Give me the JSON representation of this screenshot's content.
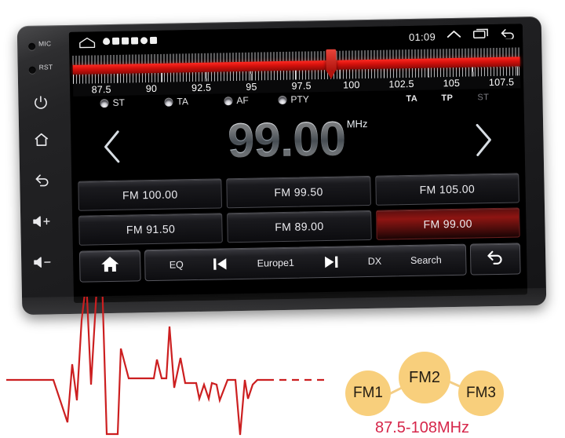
{
  "device": {
    "left_buttons": [
      {
        "name": "mic-hole",
        "label": "MIC",
        "icon": "hole"
      },
      {
        "name": "reset-hole",
        "label": "RST",
        "icon": "hole"
      },
      {
        "name": "power-button",
        "label": "",
        "icon": "power-icon"
      },
      {
        "name": "home-button",
        "label": "",
        "icon": "home-icon"
      },
      {
        "name": "back-button",
        "label": "",
        "icon": "back-arrow-icon"
      },
      {
        "name": "volume-up-button",
        "label": "",
        "icon": "volume-up-icon"
      },
      {
        "name": "volume-down-button",
        "label": "",
        "icon": "volume-down-icon"
      }
    ]
  },
  "statusbar": {
    "home_icon": "home-icon",
    "tray_icons": [
      "location-pin-icon",
      "image-icon",
      "app-icon",
      "mail-icon",
      "download-icon",
      "stop-icon"
    ],
    "time": "01:09",
    "expand_icon": "chevron-up-icon",
    "recents_icon": "recent-apps-icon",
    "back_icon": "back-arrow-icon"
  },
  "tuner": {
    "scale_labels": [
      "87.5",
      "90",
      "92.5",
      "95",
      "97.5",
      "100",
      "102.5",
      "105",
      "107.5"
    ],
    "scale_min": 87.5,
    "scale_max": 107.5,
    "cursor_value": 99.0,
    "bar_color": "#d5110c",
    "cursor_color": "#b2140e"
  },
  "rds": {
    "leds": [
      {
        "name": "st-indicator",
        "label": "ST"
      },
      {
        "name": "ta-indicator",
        "label": "TA"
      },
      {
        "name": "af-indicator",
        "label": "AF"
      },
      {
        "name": "pty-indicator",
        "label": "PTY"
      }
    ],
    "status_right": [
      {
        "name": "ta-status",
        "label": "TA",
        "dim": false
      },
      {
        "name": "tp-status",
        "label": "TP",
        "dim": false
      },
      {
        "name": "st-status",
        "label": "ST",
        "dim": true
      }
    ]
  },
  "frequency": {
    "value": "99.00",
    "unit": "MHz",
    "prev_icon": "chevron-left-icon",
    "next_icon": "chevron-right-icon"
  },
  "presets": [
    {
      "name": "preset-1",
      "label": "FM  100.00",
      "active": false
    },
    {
      "name": "preset-2",
      "label": "FM  99.50",
      "active": false
    },
    {
      "name": "preset-3",
      "label": "FM  105.00",
      "active": false
    },
    {
      "name": "preset-4",
      "label": "FM  91.50",
      "active": false
    },
    {
      "name": "preset-5",
      "label": "FM  89.00",
      "active": false
    },
    {
      "name": "preset-6",
      "label": "FM  99.00",
      "active": true
    }
  ],
  "toolbar": {
    "home_icon": "home-icon",
    "items": [
      {
        "name": "eq-button",
        "label": "EQ",
        "icon": ""
      },
      {
        "name": "previous-station-button",
        "label": "",
        "icon": "skip-previous-icon"
      },
      {
        "name": "station-name",
        "label": "Europe1",
        "icon": ""
      },
      {
        "name": "next-station-button",
        "label": "",
        "icon": "skip-next-icon"
      },
      {
        "name": "dx-button",
        "label": "DX",
        "icon": ""
      },
      {
        "name": "search-button",
        "label": "Search",
        "icon": ""
      }
    ],
    "back_icon": "return-arrow-icon"
  },
  "graphic": {
    "band_circles": [
      {
        "name": "fm1-badge",
        "label": "FM1"
      },
      {
        "name": "fm2-badge",
        "label": "FM2"
      },
      {
        "name": "fm3-badge",
        "label": "FM3"
      }
    ],
    "range_text": "87.5-108MHz",
    "circle_color": "#f8cf7c",
    "range_color": "#d6264a",
    "wave_color": "#cc1f20"
  }
}
